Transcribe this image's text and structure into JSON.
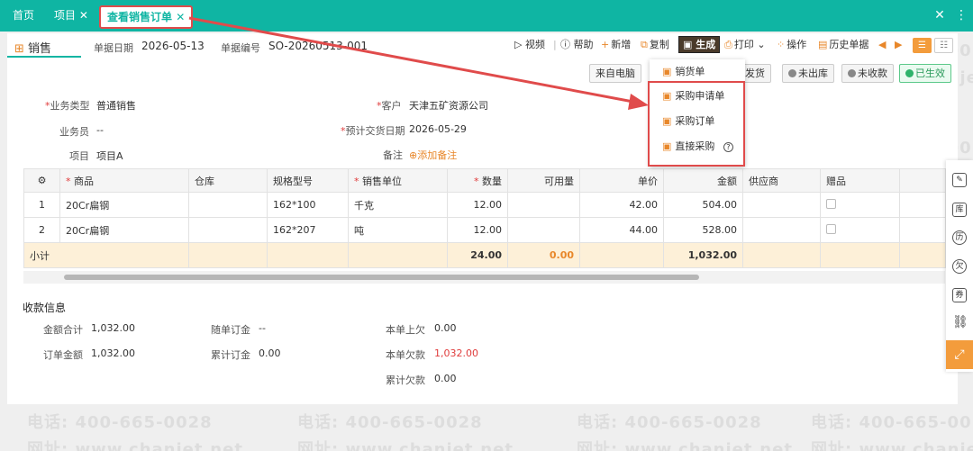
{
  "tabs": {
    "home": "首页",
    "project": "项目",
    "project_close": "✕",
    "active": "查看销售订单",
    "active_close": "✕"
  },
  "window": {
    "close": "✕",
    "more": "⋮"
  },
  "header": {
    "module": "销售",
    "date_label": "单据日期",
    "date_value": "2026-05-13",
    "code_label": "单据编号",
    "code_value": "SO-20260513-001"
  },
  "toolbar": {
    "video": "视频",
    "help": "帮助",
    "add": "新增",
    "copy": "复制",
    "generate": "生成",
    "print": "打印",
    "operate": "操作",
    "history": "历史单据"
  },
  "status": {
    "from_pc": "来自电脑",
    "delivery": "发货",
    "not_out": "未出库",
    "not_received": "未收款",
    "effective": "已生效"
  },
  "menu": {
    "items": [
      "销货单",
      "采购申请单",
      "采购订单",
      "直接采购"
    ],
    "help_mark": "?"
  },
  "form": {
    "biz_type_label": "业务类型",
    "biz_type_value": "普通销售",
    "customer_label": "客户",
    "customer_value": "天津五矿资源公司",
    "salesman_label": "业务员",
    "salesman_value": "--",
    "delivery_date_label": "预计交货日期",
    "delivery_date_value": "2026-05-29",
    "project_label": "项目",
    "project_value": "项目A",
    "note_label": "备注",
    "add_note": "添加备注"
  },
  "table": {
    "headers": [
      "",
      "商品",
      "仓库",
      "规格型号",
      "销售单位",
      "数量",
      "可用量",
      "单价",
      "金额",
      "供应商",
      "赠品"
    ],
    "rows": [
      {
        "idx": "1",
        "product": "20Cr扁钢",
        "warehouse": "",
        "spec": "162*100",
        "unit": "千克",
        "qty": "12.00",
        "avail": "",
        "price": "42.00",
        "amount": "504.00",
        "supplier": ""
      },
      {
        "idx": "2",
        "product": "20Cr扁钢",
        "warehouse": "",
        "spec": "162*207",
        "unit": "吨",
        "qty": "12.00",
        "avail": "",
        "price": "44.00",
        "amount": "528.00",
        "supplier": ""
      }
    ],
    "subtotal": {
      "label": "小计",
      "qty": "24.00",
      "avail": "0.00",
      "amount": "1,032.00"
    }
  },
  "payment": {
    "title": "收款信息",
    "total_label": "金额合计",
    "total_value": "1,032.00",
    "deposit_label": "随单订金",
    "deposit_value": "--",
    "prev_debt_label": "本单上欠",
    "prev_debt_value": "0.00",
    "order_amount_label": "订单金额",
    "order_amount_value": "1,032.00",
    "acc_deposit_label": "累计订金",
    "acc_deposit_value": "0.00",
    "debt_label": "本单欠款",
    "debt_value": "1,032.00",
    "acc_debt_label": "累计欠款",
    "acc_debt_value": "0.00"
  },
  "watermark": {
    "phone": "电话: 400-665-0028",
    "site": "网址: www.chanjet.net"
  },
  "colors": {
    "accent": "#0fb5a3",
    "highlight": "#e04b4b",
    "orange": "#e8872a"
  }
}
